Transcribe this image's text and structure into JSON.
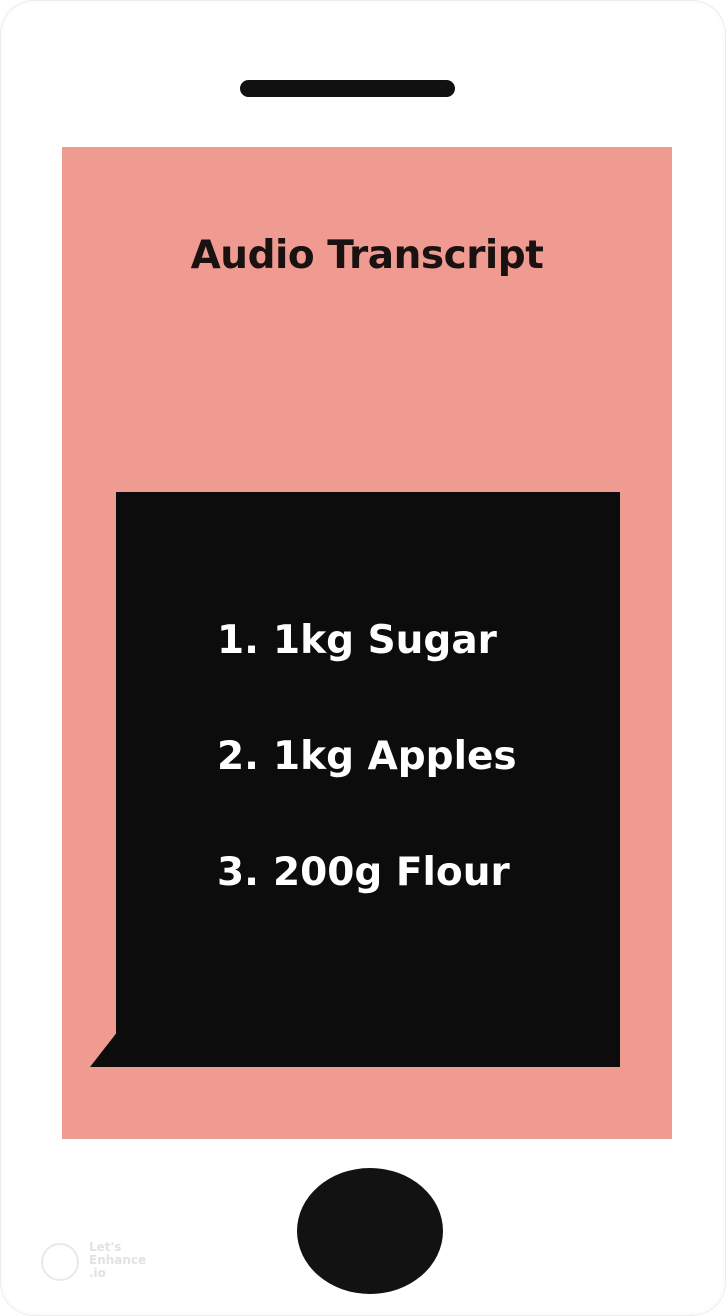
{
  "screen": {
    "title": "Audio Transcript",
    "transcript": {
      "items": [
        {
          "number": "1.",
          "text": "1kg Sugar"
        },
        {
          "number": "2.",
          "text": "1kg Apples"
        },
        {
          "number": "3.",
          "text": "200g Flour"
        }
      ]
    }
  },
  "watermark": {
    "text": "Let's Enhance .io"
  },
  "colors": {
    "screen_background": "#f09b92",
    "bubble_background": "#0c0c0c",
    "text_light": "#ffffff",
    "title_text": "#1a1210"
  },
  "icons": {
    "speaker": "earpiece-speaker-icon",
    "home": "home-button-icon",
    "watermark": "letsenhance-logo-icon"
  }
}
